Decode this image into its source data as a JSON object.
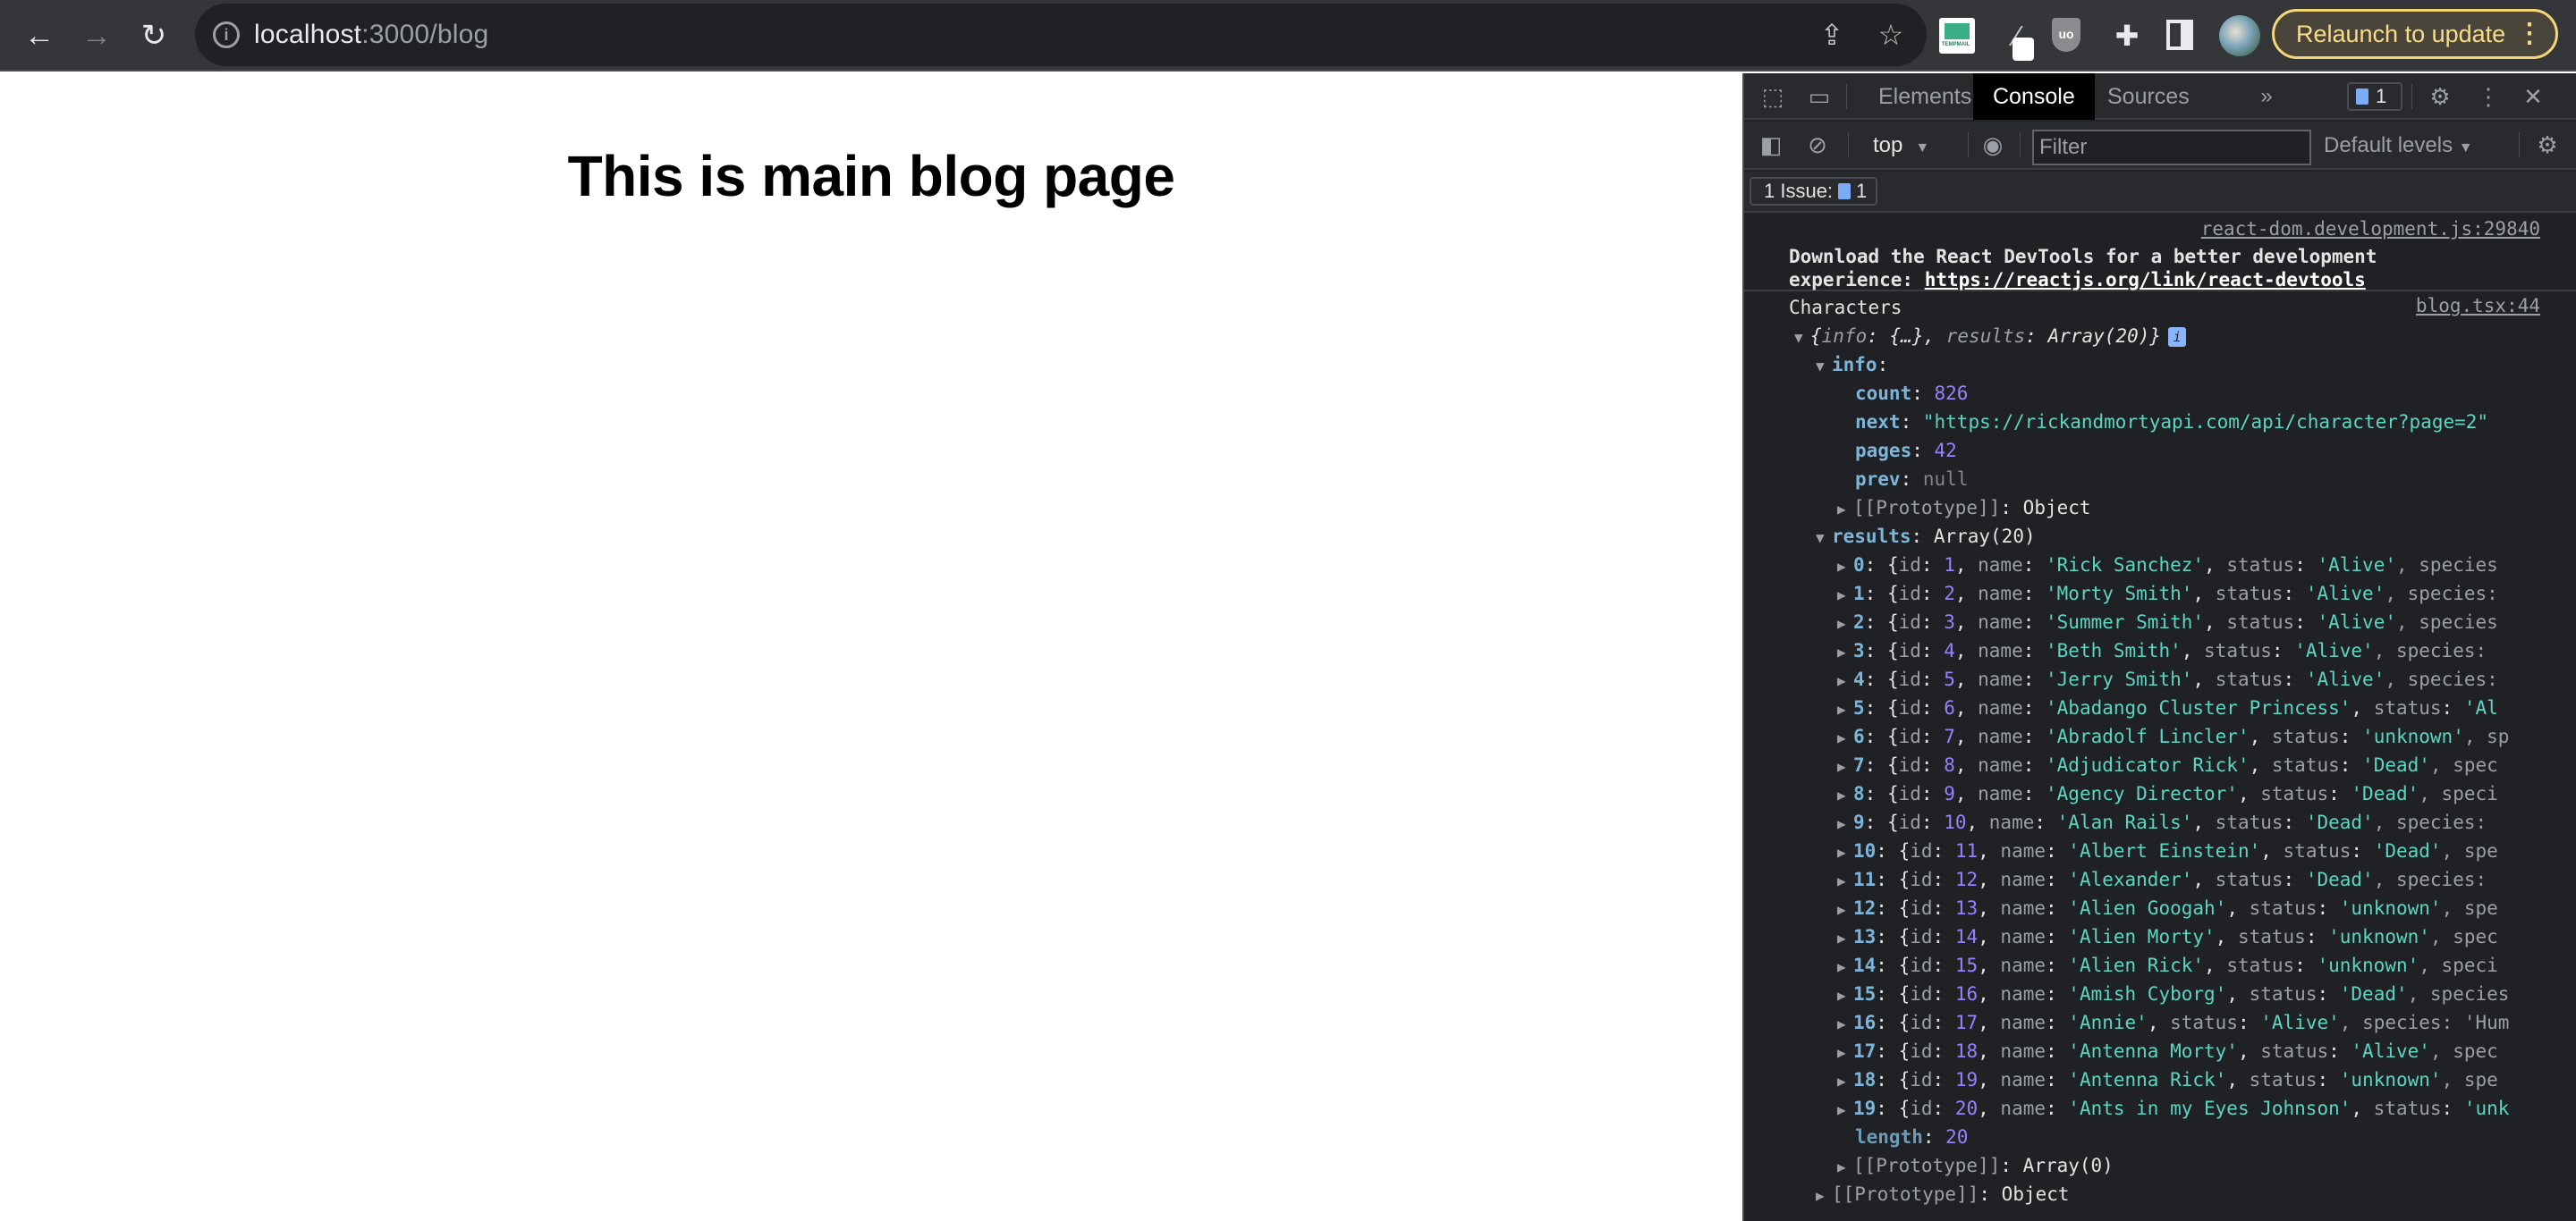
{
  "browser": {
    "url_host": "localhost",
    "url_rest": ":3000/blog",
    "relaunch_label": "Relaunch to update",
    "icons": [
      "back-icon",
      "forward-icon",
      "reload-icon",
      "site-info-icon",
      "share-icon",
      "bookmark-star-icon",
      "tempmail-extension-icon",
      "eyedropper-extension-icon",
      "ublock-extension-icon",
      "extensions-puzzle-icon",
      "side-panel-icon",
      "profile-avatar",
      "more-menu-icon"
    ]
  },
  "page": {
    "heading": "This is main blog page"
  },
  "devtools": {
    "tabs": [
      {
        "label": "Elements",
        "active": false
      },
      {
        "label": "Console",
        "active": true
      },
      {
        "label": "Sources",
        "active": false
      }
    ],
    "more_tabs": "»",
    "issue_count": "1",
    "context": "top",
    "filter_placeholder": "Filter",
    "levels": "Default levels",
    "issues_label": "1 Issue:",
    "issues_count": "1",
    "messages": [
      {
        "source": "react-dom.development.js:29840",
        "text": "Download the React DevTools for a better development experience: ",
        "link": "https://reactjs.org/link/react-devtools"
      },
      {
        "source": "blog.tsx:44",
        "label": "Characters",
        "summary": {
          "info": "{…}",
          "results": "Array(20)"
        },
        "info": {
          "count": "826",
          "next": "\"https://rickandmortyapi.com/api/character?page=2\"",
          "pages": "42",
          "prev": "null",
          "prototype": "Object"
        },
        "results_label": "Array(20)",
        "results": [
          {
            "index": "0",
            "id": "1",
            "name": "'Rick Sanchez'",
            "status": "'Alive'",
            "tail": ", species"
          },
          {
            "index": "1",
            "id": "2",
            "name": "'Morty Smith'",
            "status": "'Alive'",
            "tail": ", species:"
          },
          {
            "index": "2",
            "id": "3",
            "name": "'Summer Smith'",
            "status": "'Alive'",
            "tail": ", species"
          },
          {
            "index": "3",
            "id": "4",
            "name": "'Beth Smith'",
            "status": "'Alive'",
            "tail": ", species:"
          },
          {
            "index": "4",
            "id": "5",
            "name": "'Jerry Smith'",
            "status": "'Alive'",
            "tail": ", species:"
          },
          {
            "index": "5",
            "id": "6",
            "name": "'Abadango Cluster Princess'",
            "status": "'Al",
            "tail": ""
          },
          {
            "index": "6",
            "id": "7",
            "name": "'Abradolf Lincler'",
            "status": "'unknown'",
            "tail": ", sp"
          },
          {
            "index": "7",
            "id": "8",
            "name": "'Adjudicator Rick'",
            "status": "'Dead'",
            "tail": ", spec"
          },
          {
            "index": "8",
            "id": "9",
            "name": "'Agency Director'",
            "status": "'Dead'",
            "tail": ", speci"
          },
          {
            "index": "9",
            "id": "10",
            "name": "'Alan Rails'",
            "status": "'Dead'",
            "tail": ", species:"
          },
          {
            "index": "10",
            "id": "11",
            "name": "'Albert Einstein'",
            "status": "'Dead'",
            "tail": ", spe"
          },
          {
            "index": "11",
            "id": "12",
            "name": "'Alexander'",
            "status": "'Dead'",
            "tail": ", species:"
          },
          {
            "index": "12",
            "id": "13",
            "name": "'Alien Googah'",
            "status": "'unknown'",
            "tail": ", spe"
          },
          {
            "index": "13",
            "id": "14",
            "name": "'Alien Morty'",
            "status": "'unknown'",
            "tail": ", spec"
          },
          {
            "index": "14",
            "id": "15",
            "name": "'Alien Rick'",
            "status": "'unknown'",
            "tail": ", speci"
          },
          {
            "index": "15",
            "id": "16",
            "name": "'Amish Cyborg'",
            "status": "'Dead'",
            "tail": ", species"
          },
          {
            "index": "16",
            "id": "17",
            "name": "'Annie'",
            "status": "'Alive'",
            "tail": ", species: 'Hum"
          },
          {
            "index": "17",
            "id": "18",
            "name": "'Antenna Morty'",
            "status": "'Alive'",
            "tail": ", spec"
          },
          {
            "index": "18",
            "id": "19",
            "name": "'Antenna Rick'",
            "status": "'unknown'",
            "tail": ", spe"
          },
          {
            "index": "19",
            "id": "20",
            "name": "'Ants in my Eyes Johnson'",
            "status": "'unk",
            "tail": ""
          }
        ],
        "results_length": "20",
        "results_prototype": "Array(0)",
        "root_prototype": "Object"
      }
    ]
  }
}
